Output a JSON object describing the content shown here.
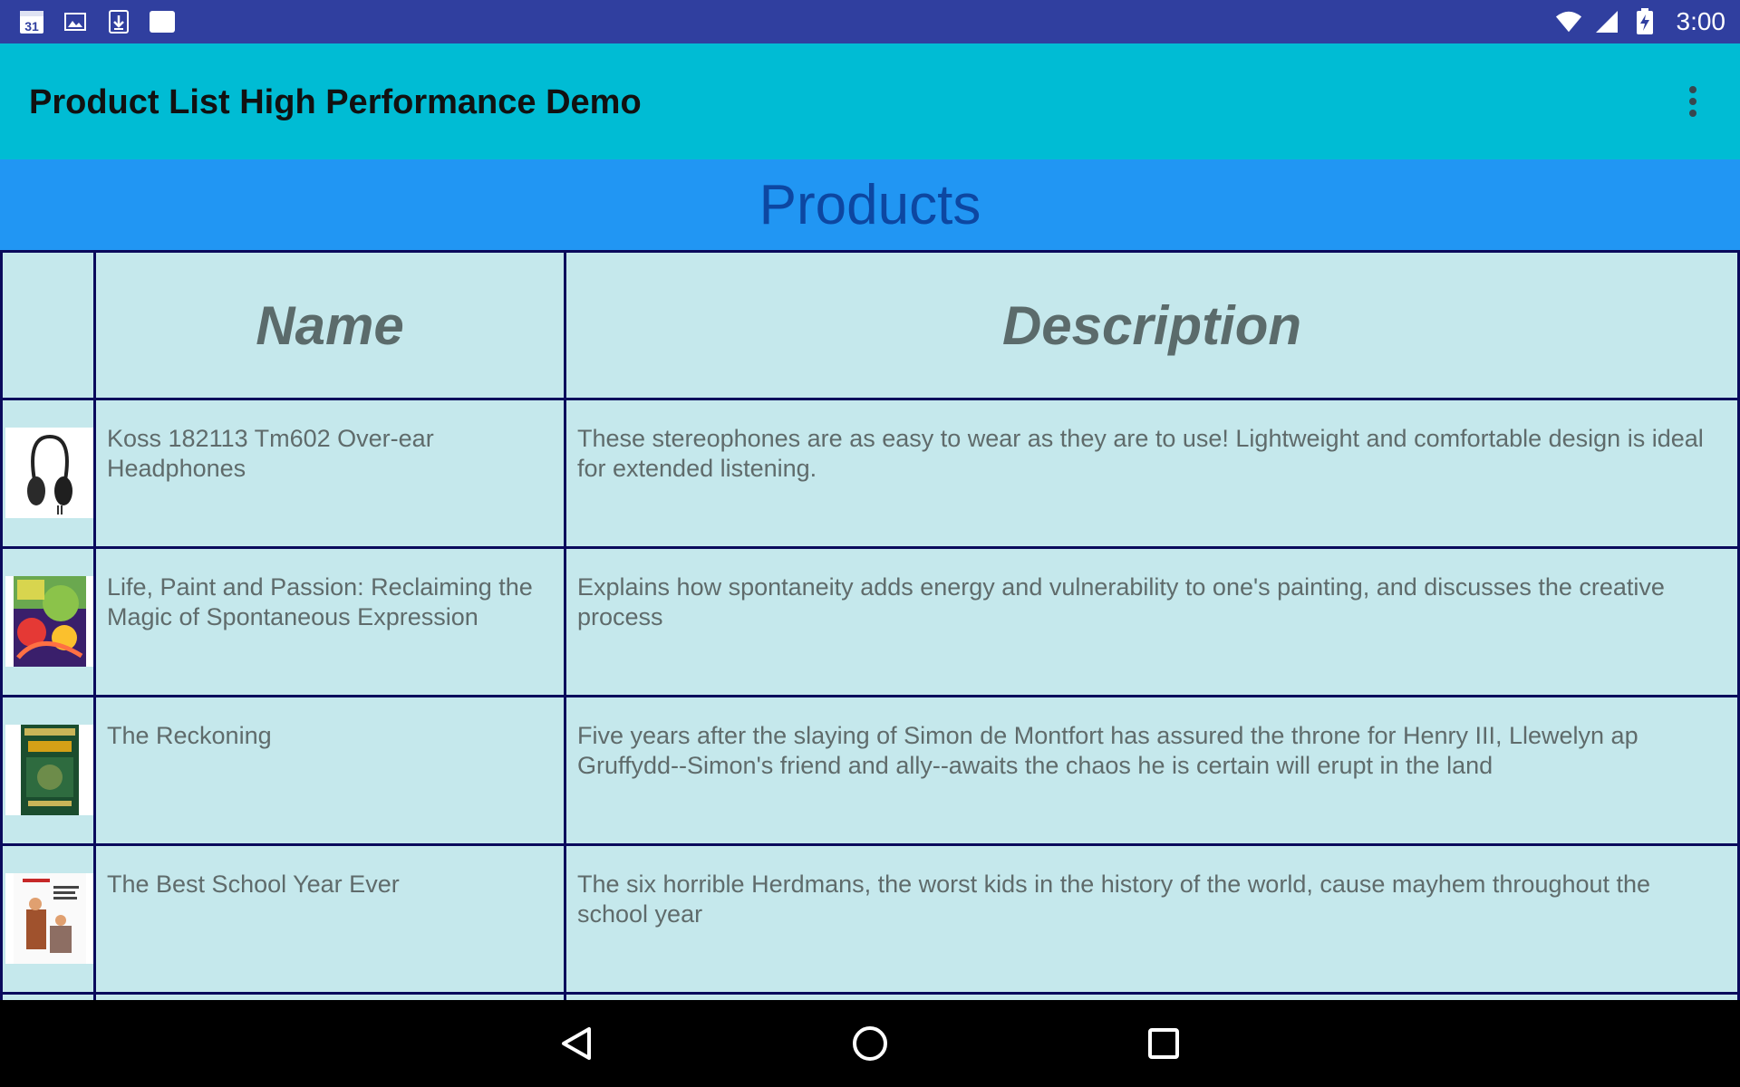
{
  "status_bar": {
    "calendar_day": "31",
    "time": "3:00",
    "colors": {
      "background": "#303f9f"
    }
  },
  "app_bar": {
    "title": "Product List High Performance Demo",
    "overflow_icon": "more-vert-icon",
    "colors": {
      "background": "#00bcd4"
    }
  },
  "section": {
    "title": "Products",
    "colors": {
      "background": "#2196f3",
      "text": "#0d47a1"
    }
  },
  "table": {
    "headers": {
      "image": "",
      "name": "Name",
      "description": "Description"
    },
    "rows": [
      {
        "thumbnail": "headphones-thumbnail",
        "name": "Koss 182113 Tm602 Over-ear Headphones",
        "description": "These stereophones are as easy to wear as they are to use! Lightweight and comfortable design is ideal for extended listening."
      },
      {
        "thumbnail": "book-cover-life-paint-passion",
        "name": "Life, Paint and Passion: Reclaiming the Magic of Spontaneous Expression",
        "description": "Explains how spontaneity adds energy and vulnerability to one's painting, and discusses the creative process"
      },
      {
        "thumbnail": "book-cover-the-reckoning",
        "name": "The Reckoning",
        "description": "Five years after the slaying of Simon de Montfort has assured the throne for Henry III, Llewelyn ap Gruffydd--Simon's friend and ally--awaits the chaos he is certain will erupt in the land"
      },
      {
        "thumbnail": "book-cover-best-school-year-ever",
        "name": "The Best School Year Ever",
        "description": "The six horrible Herdmans, the worst kids in the history of the world, cause mayhem throughout the school year"
      }
    ],
    "colors": {
      "cell_background": "#c5e8ec",
      "border": "#0a0a5c",
      "text": "#5f6b6b"
    }
  },
  "nav_bar": {
    "back_icon": "back-triangle-icon",
    "home_icon": "home-circle-icon",
    "recents_icon": "recents-square-icon"
  }
}
